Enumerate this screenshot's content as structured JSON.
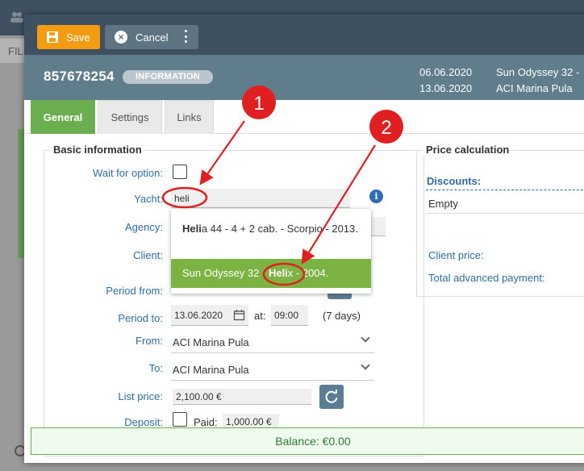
{
  "background": {
    "fi_label": "FIL"
  },
  "toolbar": {
    "save_label": "Save",
    "cancel_label": "Cancel",
    "cancel_icon": "×"
  },
  "header": {
    "booking_number": "857678254",
    "badge": "INFORMATION",
    "date_from": "06.06.2020",
    "date_to": "13.06.2020",
    "yacht": "Sun Odyssey 32 -",
    "base": "ACI Marina Pula"
  },
  "tabs": [
    "General",
    "Settings",
    "Links"
  ],
  "basic": {
    "title": "Basic information",
    "wait_label": "Wait for option:",
    "yacht_label": "Yacht:",
    "yacht_value": "heli",
    "agency_label": "Agency:",
    "client_label": "Client:",
    "period_from_label": "Period from:",
    "period_to_label": "Period to:",
    "period_to_value": "13.06.2020",
    "at_label": "at:",
    "time_value": "09:00",
    "days": "(7 days)",
    "from_label": "From:",
    "from_value": "ACI Marina Pula",
    "to_label": "To:",
    "to_value": "ACI Marina Pula",
    "list_price_label": "List price:",
    "list_price_value": "2,100.00 €",
    "deposit_label": "Deposit:",
    "paid_label": "Paid:",
    "paid_value": "1,000.00 €"
  },
  "dropdown": {
    "items": [
      {
        "match": "Heli",
        "rest": "a 44 - 4 + 2 cab. - Scorpio - 2013."
      },
      {
        "pre": "Sun Odyssey 32 - ",
        "match": "Heli",
        "rest": "x - 2004."
      }
    ]
  },
  "price": {
    "title": "Price calculation",
    "discounts_label": "Discounts:",
    "discounts_value": "Empty",
    "client_price_label": "Client price:",
    "total_adv_label": "Total advanced payment:"
  },
  "balance": "Balance: €0.00",
  "annotations": {
    "marker1": "1",
    "marker2": "2"
  },
  "colors": {
    "save": "#f39c12",
    "toolbar": "#3f5160",
    "header": "#607d8b",
    "active_tab": "#6aae4f",
    "highlight": "#7cb342",
    "annotation": "#e02020"
  }
}
